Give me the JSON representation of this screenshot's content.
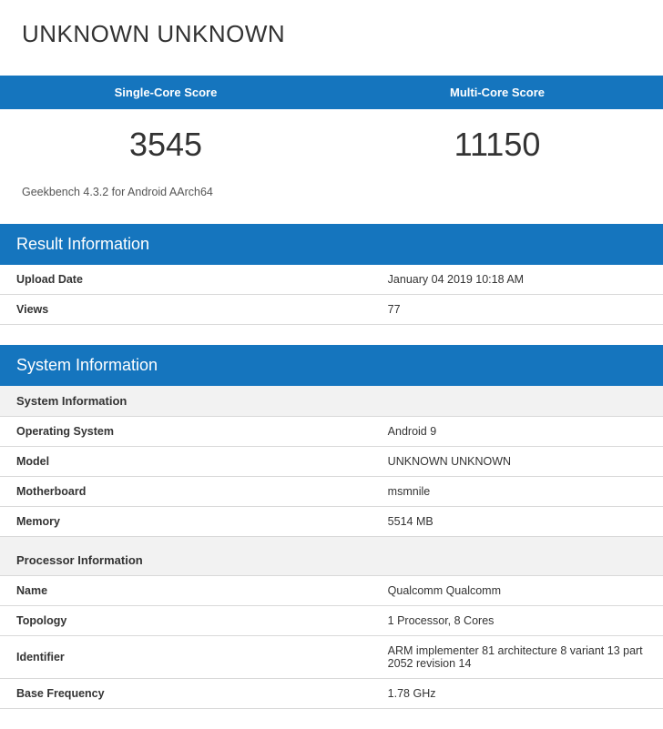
{
  "title": "UNKNOWN UNKNOWN",
  "scores": {
    "single_label": "Single-Core Score",
    "single_value": "3545",
    "multi_label": "Multi-Core Score",
    "multi_value": "11150"
  },
  "subtitle": "Geekbench 4.3.2 for Android AArch64",
  "result_section": {
    "header": "Result Information",
    "rows": [
      {
        "label": "Upload Date",
        "value": "January 04 2019 10:18 AM"
      },
      {
        "label": "Views",
        "value": "77"
      }
    ]
  },
  "system_section": {
    "header": "System Information",
    "sub1": "System Information",
    "rows1": [
      {
        "label": "Operating System",
        "value": "Android 9"
      },
      {
        "label": "Model",
        "value": "UNKNOWN UNKNOWN"
      },
      {
        "label": "Motherboard",
        "value": "msmnile"
      },
      {
        "label": "Memory",
        "value": "5514 MB"
      }
    ],
    "sub2": "Processor Information",
    "rows2": [
      {
        "label": "Name",
        "value": "Qualcomm Qualcomm"
      },
      {
        "label": "Topology",
        "value": "1 Processor, 8 Cores"
      },
      {
        "label": "Identifier",
        "value": "ARM implementer 81 architecture 8 variant 13 part 2052 revision 14"
      },
      {
        "label": "Base Frequency",
        "value": "1.78 GHz"
      }
    ]
  }
}
